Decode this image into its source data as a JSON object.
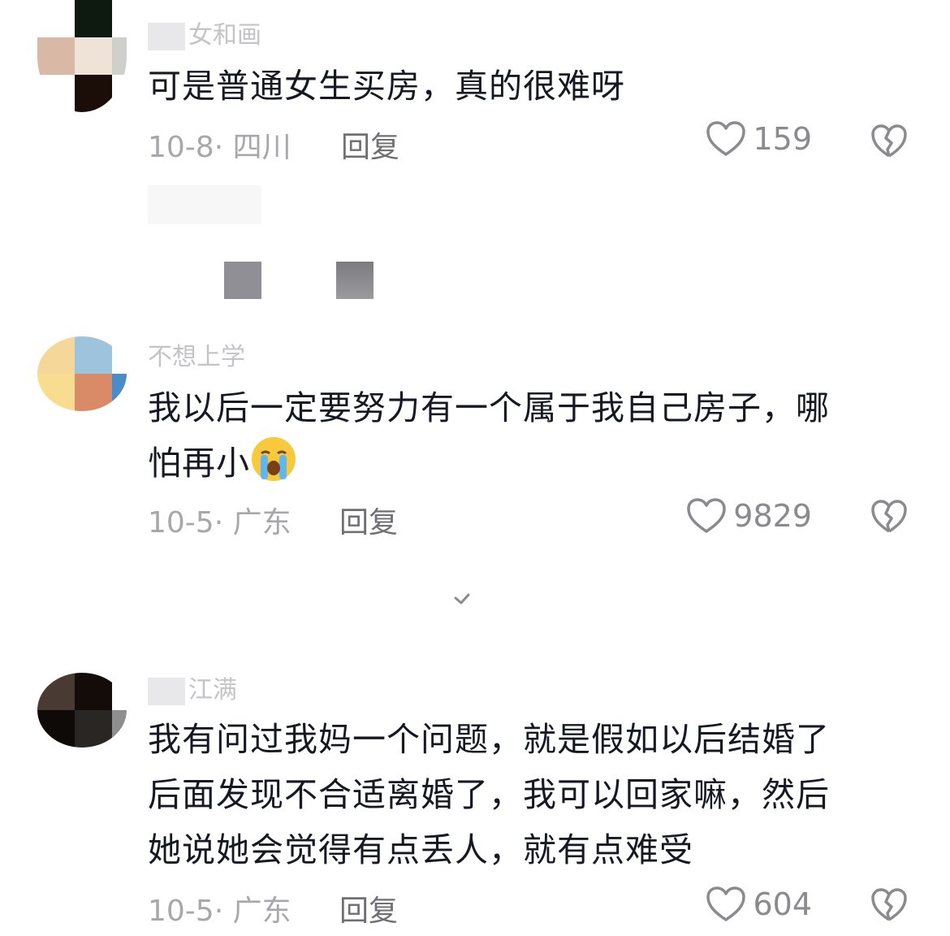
{
  "comments": [
    {
      "username": "女和画",
      "text": "可是普通女生买房，真的很难呀",
      "meta": "10-8· 四川",
      "reply_label": "回复",
      "likes": "159"
    },
    {
      "username": "不想上学",
      "text_line1": "我以后一定要努力有一个属于我自己房子，哪",
      "text_line2": "怕再小",
      "emoji": "loudly-crying-face",
      "meta": "10-5· 广东",
      "reply_label": "回复",
      "likes": "9829"
    },
    {
      "username": "江满",
      "text_line1": "我有问过我妈一个问题，就是假如以后结婚了",
      "text_line2": "后面发现不合适离婚了，我可以回家嘛，然后",
      "text_line3": "她说她会觉得有点丢人，就有点难受",
      "meta": "10-5· 广东",
      "reply_label": "回复",
      "likes": "604"
    }
  ],
  "colors": {
    "text": "#161823",
    "meta": "#a8a8ac",
    "icon": "#8a8a8f"
  }
}
